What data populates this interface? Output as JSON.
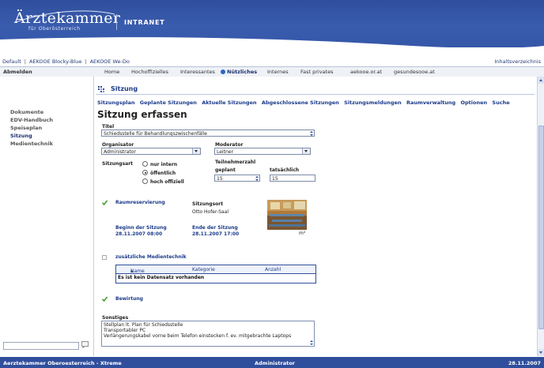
{
  "header": {
    "logo_title": "Ärztekammer",
    "logo_sub": "für Oberösterreich",
    "section": "INTRANET"
  },
  "toplinks": {
    "items": [
      "Default",
      "AEKOOE Blocky-Blue",
      "AEKOOE We-Do"
    ],
    "right": "Inhaltsverzeichnis"
  },
  "navbar": {
    "logout": "Abmelden",
    "tabs": [
      "Home",
      "Hochoffizielles",
      "Interessantes",
      "Nützliches",
      "Internes",
      "Fast privates",
      "aekooe.or.at",
      "gesundesooe.at"
    ],
    "active": "Nützliches"
  },
  "sidebar": {
    "items": [
      "Dokumente",
      "EDV-Handbuch",
      "Speiseplan",
      "Sitzung",
      "Medientechnik"
    ],
    "active": "Sitzung"
  },
  "section_title": "Sitzung",
  "subnav": [
    "Sitzungsplan",
    "Geplante Sitzungen",
    "Aktuelle Sitzungen",
    "Abgeschlossene Sitzungen",
    "Sitzungsmeldungen",
    "Raumverwaltung",
    "Optionen",
    "Suche"
  ],
  "form": {
    "page_title": "Sitzung erfassen",
    "titel_label": "Titel",
    "titel_value": "Schiedsstelle für Behandlungszwischenfälle",
    "organisator_label": "Organisator",
    "organisator_value": "Administrator",
    "moderator_label": "Moderator",
    "moderator_value": "Leitner",
    "sitzungsart_label": "Sitzungsart",
    "sitzungsart_options": [
      "nur intern",
      "öffentlich",
      "hoch offiziell"
    ],
    "sitzungsart_selected": "öffentlich",
    "teilnehmer_label": "Teilnehmerzahl",
    "geplant_label": "geplant",
    "geplant_value": "15",
    "tatsaechlich_label": "tatsächlich",
    "tatsaechlich_value": "15",
    "raumreservierung_label": "Raumreservierung",
    "sitzungsort_label": "Sitzungsort",
    "sitzungsort_value": "Otto Hofer-Saal",
    "m2_label": "m²",
    "beginn_label": "Beginn der Sitzung",
    "beginn_value": "28.11.2007 08:00",
    "ende_label": "Ende der Sitzung",
    "ende_value": "28.11.2007 17:00",
    "medientechnik_label": "zusätzliche Medientechnik",
    "grid_columns": [
      "Name",
      "Kategorie",
      "Anzahl"
    ],
    "grid_empty": "Es ist kein Datensatz vorhanden",
    "bewirtung_label": "Bewirtung",
    "sonstiges_label": "Sonstiges",
    "sonstiges_lines": [
      "Stellplan lt. Plan für Schiedsstelle",
      "Transportabler PC",
      "Verlängerungskabel vorne beim Telefon einstecken f. ev. mitgebrachte Laptops"
    ]
  },
  "footer": {
    "left": "Aerztekammer Oberoesterreich - Xtreme",
    "center": "Administrator",
    "right": "28.11.2007"
  }
}
